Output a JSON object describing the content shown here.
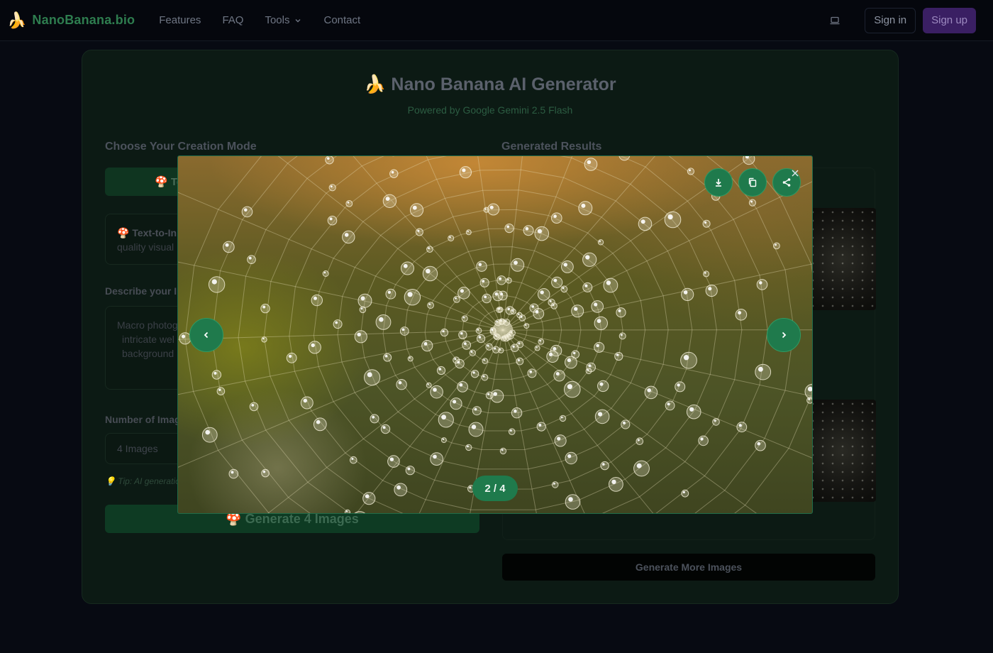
{
  "nav": {
    "brand_icon": "🍌",
    "brand_name": "NanoBanana.bio",
    "links": [
      "Features",
      "FAQ",
      "Tools",
      "Contact"
    ],
    "sign_in": "Sign in",
    "sign_up": "Sign up"
  },
  "hero": {
    "title": "🍌 Nano Banana AI Generator",
    "subtitle": "Powered by Google Gemini 2.5 Flash"
  },
  "left": {
    "mode_title": "Choose Your Creation Mode",
    "mode_tab_partial": "🍄 Te",
    "info_bold_partial": "🍄 Text-to-In",
    "info_line2_partial": "quality visual",
    "prompt_label_partial": "Describe your In",
    "prompt_lines_partial": [
      "Macro photog",
      "intricate wel",
      "background"
    ],
    "count_label_partial": "Number of Imag",
    "count_value": "4 Images",
    "tip_partial": "💡 Tip: AI generatio",
    "generate_label": "🍄 Generate 4 Images"
  },
  "right": {
    "results_title": "Generated Results",
    "more_button": "Generate More Images"
  },
  "lightbox": {
    "current": 2,
    "total": 4,
    "counter_text": "2 / 4"
  },
  "colors": {
    "accent_green": "#1f7a4c",
    "brand_green": "#2e7d4f",
    "signup_purple": "#3a1f63"
  }
}
